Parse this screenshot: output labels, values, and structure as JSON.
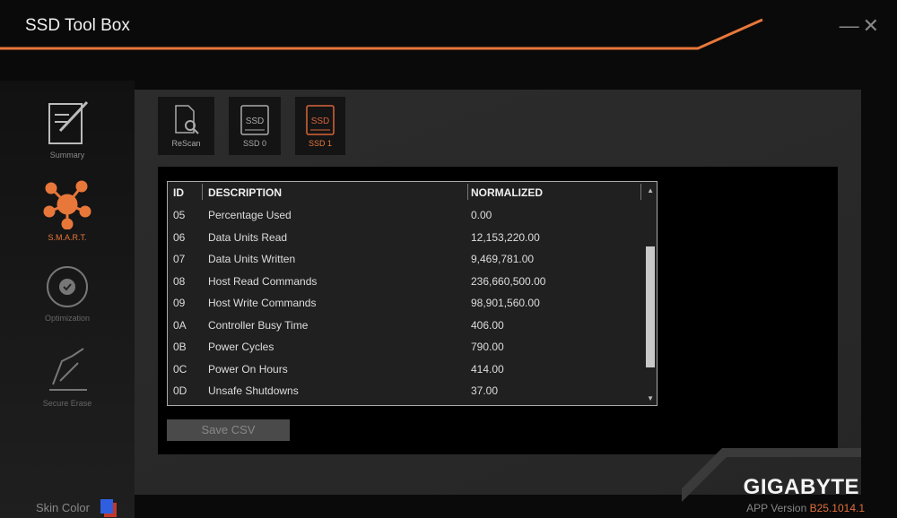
{
  "app": {
    "title": "SSD Tool Box",
    "accent": "#e8773a"
  },
  "sidebar": {
    "items": [
      {
        "label": "Summary",
        "icon": "notepad-pen-icon"
      },
      {
        "label": "S.M.A.R.T.",
        "icon": "network-nodes-icon",
        "active": true
      },
      {
        "label": "Optimization",
        "icon": "refresh-check-icon"
      },
      {
        "label": "Secure Erase",
        "icon": "hand-erase-icon"
      }
    ],
    "skin_color_label": "Skin Color"
  },
  "toolbar": [
    {
      "label": "ReScan",
      "icon": "document-search-icon"
    },
    {
      "label": "SSD 0",
      "icon": "ssd-icon"
    },
    {
      "label": "SSD 1",
      "icon": "ssd-icon",
      "active": true
    }
  ],
  "table": {
    "columns": [
      "ID",
      "DESCRIPTION",
      "NORMALIZED"
    ],
    "rows": [
      [
        "05",
        "Percentage Used",
        "0.00"
      ],
      [
        "06",
        "Data Units Read",
        "12,153,220.00"
      ],
      [
        "07",
        "Data Units Written",
        "9,469,781.00"
      ],
      [
        "08",
        "Host Read Commands",
        "236,660,500.00"
      ],
      [
        "09",
        "Host Write Commands",
        "98,901,560.00"
      ],
      [
        "0A",
        "Controller Busy Time",
        "406.00"
      ],
      [
        "0B",
        "Power Cycles",
        "790.00"
      ],
      [
        "0C",
        "Power On Hours",
        "414.00"
      ],
      [
        "0D",
        "Unsafe Shutdowns",
        "37.00"
      ]
    ]
  },
  "save_label": "Save CSV",
  "brand": {
    "logo": "GIGABYTE",
    "version_label": "APP Version",
    "version": "B25.1014.1"
  }
}
